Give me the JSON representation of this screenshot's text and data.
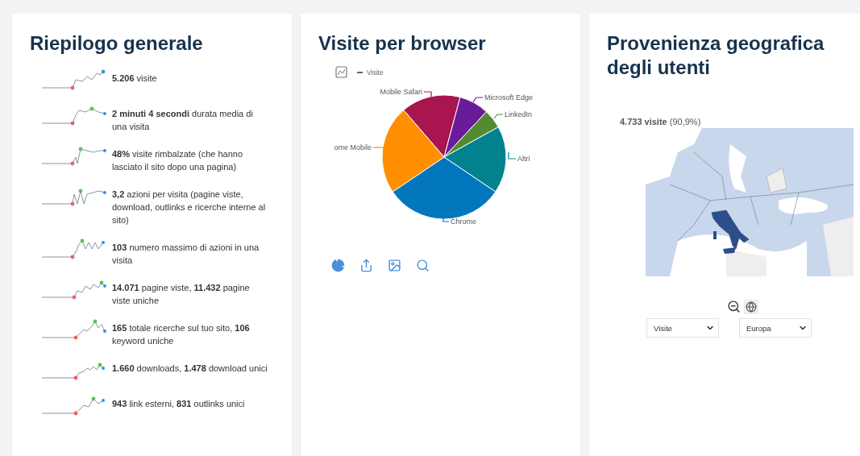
{
  "summary": {
    "title": "Riepilogo generale",
    "items": [
      {
        "text": "**5.206** visite"
      },
      {
        "text": "**2 minuti 4 secondi** durata media di una visita"
      },
      {
        "text": "**48%** visite rimbalzate (che hanno lasciato il sito dopo una pagina)"
      },
      {
        "text": "**3,2** azioni per visita (pagine viste, download, outlinks e ricerche interne al sito)"
      },
      {
        "text": "**103** numero massimo di azioni in una visita"
      },
      {
        "text": "**14.071** pagine viste, **11.432** pagine viste uniche"
      },
      {
        "text": "**165** totale ricerche sul tuo sito, **106** keyword uniche"
      },
      {
        "text": "**1.660** downloads, **1.478** download unici"
      },
      {
        "text": "**943** link esterni, **831** outlinks unici"
      }
    ]
  },
  "browsers": {
    "title": "Visite per browser",
    "legend": "Visite",
    "slices": [
      {
        "label": "Mobile Safari",
        "color": "#a8154f"
      },
      {
        "label": "Microsoft Edge",
        "color": "#6a1b9a"
      },
      {
        "label": "LinkedIn",
        "color": "#558b2f"
      },
      {
        "label": "Altri",
        "color": "#00838f"
      },
      {
        "label": "Chrome",
        "color": "#0277bd"
      },
      {
        "label": "ome Mobile",
        "color": "#ff8f00"
      }
    ]
  },
  "geo": {
    "title": "Provenienza geografica degli utenti",
    "tooltip": "**4.733 visite** (90,9%)",
    "metric": "Visite",
    "region": "Europa"
  }
}
